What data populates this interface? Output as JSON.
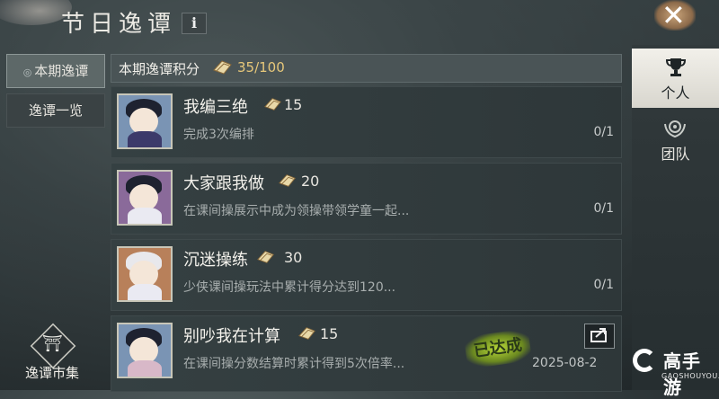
{
  "header": {
    "title": "节日逸谭",
    "info_label": "i",
    "close_label": "✕"
  },
  "left_nav": {
    "items": [
      {
        "label": "本期逸谭",
        "active": true
      },
      {
        "label": "逸谭一览",
        "active": false
      }
    ],
    "market_label": "逸谭市集"
  },
  "score": {
    "label": "本期逸谭积分",
    "value": "35/100"
  },
  "tasks": [
    {
      "title": "我编三绝",
      "points": "15",
      "description": "完成3次编排",
      "progress": "0/1"
    },
    {
      "title": "大家跟我做",
      "points": "20",
      "description": "在课间操展示中成为领操带领学童一起...",
      "progress": "0/1"
    },
    {
      "title": "沉迷操练",
      "points": "30",
      "description": "少侠课间操玩法中累计得分达到120...",
      "progress": "0/1"
    },
    {
      "title": "别吵我在计算",
      "points": "15",
      "description": "在课间操分数结算时累计得到5次倍率...",
      "date": "2025-08-2",
      "stamp": "已达成"
    }
  ],
  "right_tabs": [
    {
      "label": "个人",
      "icon": "trophy-icon",
      "active": true
    },
    {
      "label": "团队",
      "icon": "team-emblem-icon",
      "active": false
    }
  ],
  "watermark": {
    "text": "高手游",
    "sub": "GAOSHOUYOU.COM"
  },
  "colors": {
    "accent_gold": "#e6c77a",
    "panel_bg": "#2e3739",
    "stamp_green": "#b8d838"
  }
}
